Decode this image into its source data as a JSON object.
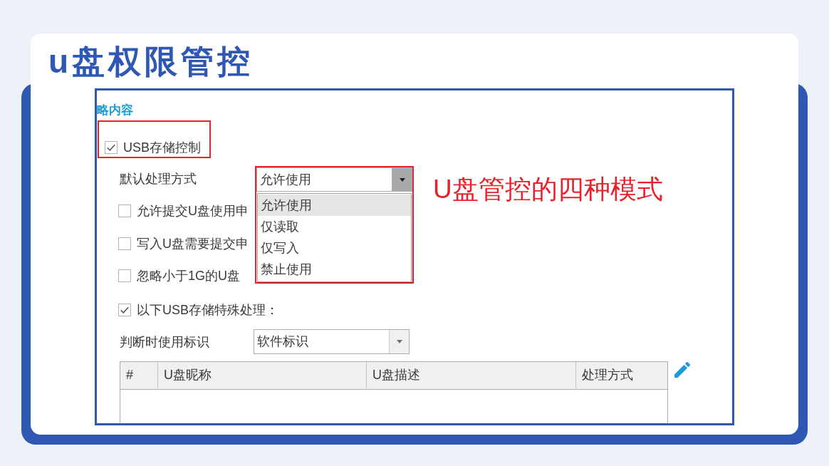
{
  "title": "u盘权限管控",
  "screenshot": {
    "section_heading": "略内容",
    "usb_storage_control": {
      "label": "USB存储控制",
      "checked": true,
      "highlighted": true
    },
    "default_action": {
      "label": "默认处理方式",
      "value": "允许使用",
      "expanded": true,
      "highlighted": true,
      "options": [
        {
          "label": "允许使用",
          "selected": true
        },
        {
          "label": "仅读取",
          "selected": false
        },
        {
          "label": "仅写入",
          "selected": false
        },
        {
          "label": "禁止使用",
          "selected": false
        }
      ]
    },
    "annotation": "U盘管控的四种模式",
    "options": [
      {
        "label": "允许提交U盘使用申",
        "checked": false
      },
      {
        "label": "写入U盘需要提交申",
        "checked": false
      },
      {
        "label": "忽略小于1G的U盘",
        "checked": false
      }
    ],
    "special_handling": {
      "label": "以下USB存储特殊处理：",
      "checked": true
    },
    "identifier": {
      "label": "判断时使用标识",
      "value": "软件标识",
      "expanded": false
    },
    "table": {
      "columns": [
        "#",
        "U盘昵称",
        "U盘描述",
        "处理方式"
      ]
    }
  }
}
